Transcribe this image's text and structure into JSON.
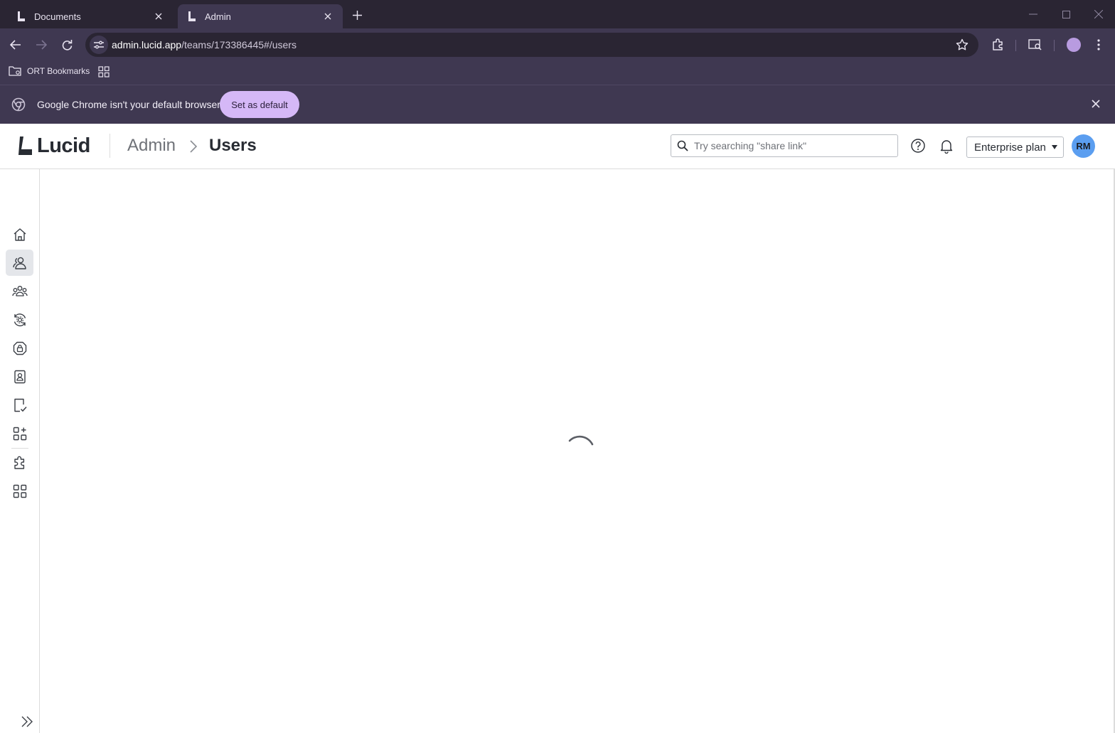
{
  "browser": {
    "tabs": [
      {
        "title": "Documents",
        "active": false
      },
      {
        "title": "Admin",
        "active": true
      }
    ],
    "url": {
      "host": "admin.lucid.app",
      "path": "/teams/173386445#/users"
    },
    "bookmarks": [
      {
        "label": "ORT Bookmarks"
      }
    ],
    "infobar": {
      "message": "Google Chrome isn't your default browser",
      "action_label": "Set as default"
    }
  },
  "app": {
    "logo_text": "Lucid",
    "breadcrumb": {
      "parent": "Admin",
      "current": "Users"
    },
    "search": {
      "placeholder": "Try searching \"share link\""
    },
    "plan_selector": {
      "value": "Enterprise plan"
    },
    "avatar_initials": "RM",
    "accent_color": "#5b9ef0"
  },
  "sidenav": {
    "items": [
      {
        "icon": "home-icon",
        "active": false
      },
      {
        "icon": "users-icon",
        "active": true
      },
      {
        "icon": "groups-icon",
        "active": false
      },
      {
        "icon": "sync-settings-icon",
        "active": false
      },
      {
        "icon": "security-lock-icon",
        "active": false
      },
      {
        "icon": "contact-card-icon",
        "active": false
      },
      {
        "icon": "document-check-icon",
        "active": false
      },
      {
        "icon": "apps-add-icon",
        "active": false
      },
      {
        "icon": "puzzle-icon",
        "active": false
      },
      {
        "icon": "grid-icon",
        "active": false
      }
    ]
  },
  "content": {
    "state": "loading"
  }
}
